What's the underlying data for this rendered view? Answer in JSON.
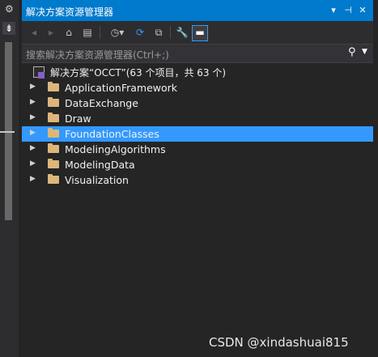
{
  "window": {
    "title": "解决方案资源管理器",
    "title_buttons": [
      "▾",
      "⊣",
      "✕"
    ]
  },
  "left_strip": {
    "gear": "⚙",
    "pin": "⇟"
  },
  "toolbar": {
    "buttons": [
      {
        "icon": "back-icon",
        "glyph": "◂"
      },
      {
        "icon": "forward-icon",
        "glyph": "▸"
      },
      {
        "icon": "home-icon",
        "glyph": "⌂"
      },
      {
        "icon": "solution-switch-icon",
        "glyph": "▤"
      },
      {
        "icon": "history-icon",
        "glyph": "◷▾"
      },
      {
        "icon": "sync-icon",
        "glyph": "⟳"
      },
      {
        "icon": "collapse-all-icon",
        "glyph": "⧉"
      },
      {
        "icon": "properties-wrench-icon",
        "glyph": "🔧"
      },
      {
        "icon": "preview-icon",
        "glyph": "▬"
      }
    ]
  },
  "search": {
    "placeholder": "搜索解决方案资源管理器(Ctrl+;)",
    "icon_glyph": "⚲",
    "dropdown_glyph": "▼"
  },
  "tree": {
    "solution_label": "解决方案“OCCT”(63 个项目，共 63 个)",
    "items": [
      {
        "label": "ApplicationFramework",
        "selected": false
      },
      {
        "label": "DataExchange",
        "selected": false
      },
      {
        "label": "Draw",
        "selected": false
      },
      {
        "label": "FoundationClasses",
        "selected": true
      },
      {
        "label": "ModelingAlgorithms",
        "selected": false
      },
      {
        "label": "ModelingData",
        "selected": false
      },
      {
        "label": "Visualization",
        "selected": false
      }
    ]
  },
  "watermark": "CSDN @xindashuai815",
  "colors": {
    "accent": "#007acc",
    "selection": "#3399ff",
    "folder": "#dcb67a",
    "background": "#252526"
  }
}
